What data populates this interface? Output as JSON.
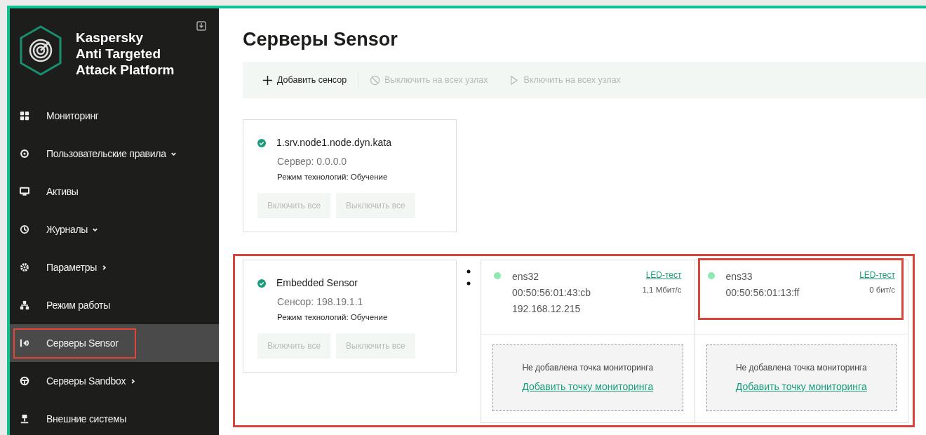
{
  "sidebar": {
    "product": [
      "Kaspersky",
      "Anti Targeted",
      "Attack Platform"
    ],
    "items": [
      {
        "label": "Мониторинг",
        "kind": "plain",
        "selected": false,
        "highlighted": false
      },
      {
        "label": "Пользовательские правила",
        "kind": "expandable",
        "selected": false,
        "highlighted": false
      },
      {
        "label": "Активы",
        "kind": "plain",
        "selected": false,
        "highlighted": false
      },
      {
        "label": "Журналы",
        "kind": "expandable",
        "selected": false,
        "highlighted": false
      },
      {
        "label": "Параметры",
        "kind": "submenu",
        "selected": false,
        "highlighted": false
      },
      {
        "label": "Режим работы",
        "kind": "plain",
        "selected": false,
        "highlighted": false
      },
      {
        "label": "Серверы Sensor",
        "kind": "plain",
        "selected": true,
        "highlighted": true
      },
      {
        "label": "Серверы Sandbox",
        "kind": "submenu",
        "selected": false,
        "highlighted": false
      },
      {
        "label": "Внешние системы",
        "kind": "plain",
        "selected": false,
        "highlighted": false
      }
    ]
  },
  "page_title": "Серверы Sensor",
  "toolbar": [
    {
      "label": "Добавить сенсор",
      "disabled": false
    },
    {
      "label": "Выключить на всех узлах",
      "disabled": true
    },
    {
      "label": "Включить на всех узлах",
      "disabled": true
    }
  ],
  "servers": [
    {
      "name": "1.srv.node1.node.dyn.kata",
      "address": "Сервер: 0.0.0.0",
      "mode": "Режим технологий: Обучение",
      "buttons": [
        "Включить все",
        "Выключить все"
      ],
      "highlighted": false
    },
    {
      "name": "Embedded Sensor",
      "address": "Сенсор: 198.19.1.1",
      "mode": "Режим технологий: Обучение",
      "buttons": [
        "Включить все",
        "Выключить все"
      ],
      "highlighted": true,
      "interfaces": [
        {
          "name": "ens32",
          "mac": "00:50:56:01:43:cb",
          "ip": "192.168.12.215",
          "led_link": "LED-тест",
          "speed": "1,1 Мбит/с",
          "highlighted": false,
          "empty_text": "Не добавлена точка мониторинга",
          "add_link": "Добавить точку мониторинга"
        },
        {
          "name": "ens33",
          "mac": "00:50:56:01:13:ff",
          "led_link": "LED-тест",
          "speed": "0 бит/с",
          "highlighted": true,
          "empty_text": "Не добавлена точка мониторинга",
          "add_link": "Добавить точку мониторинга"
        }
      ]
    }
  ]
}
